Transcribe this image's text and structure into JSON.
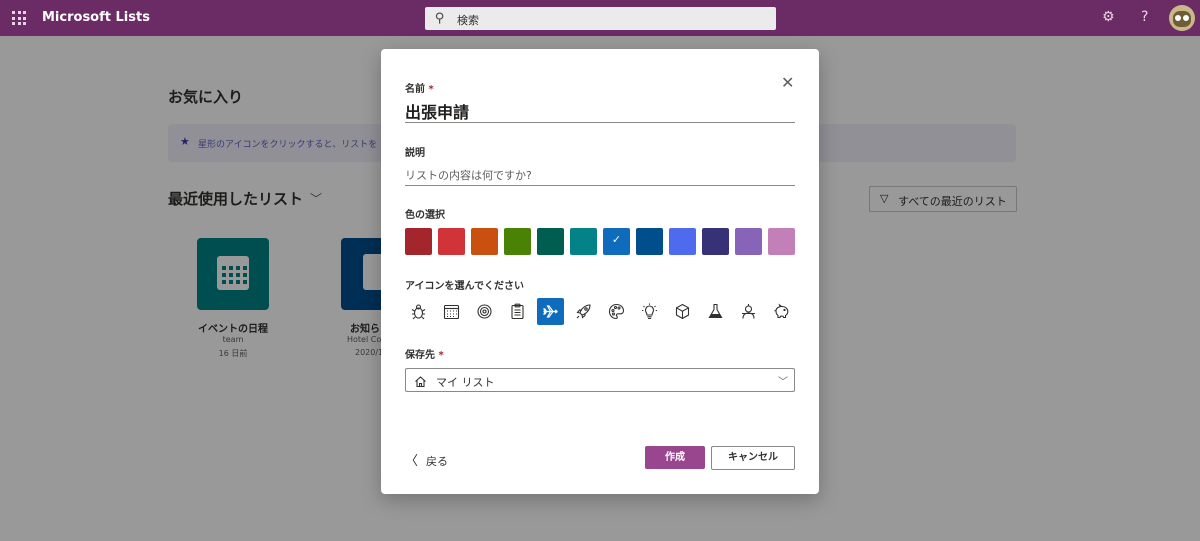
{
  "app": {
    "name": "Microsoft Lists",
    "search_placeholder": "検索"
  },
  "topbar_icons": [
    "waffle-icon",
    "gear-icon",
    "help-icon"
  ],
  "topbar": {
    "help_glyph": "?"
  },
  "background": {
    "favorites_title": "お気に入り",
    "favorites_hint": "星形のアイコンをクリックすると、リストを",
    "recent_title": "最近使用したリスト",
    "all_recent_label": "すべての最近のリスト",
    "tiles": [
      {
        "name": "イベントの日程",
        "owner": "team",
        "date": "16 日前",
        "color": "#038387"
      },
      {
        "name": "お知ら",
        "owner": "Hotel Co",
        "date": "2020/1",
        "color": "#004e8c"
      }
    ]
  },
  "dialog": {
    "name_label": "名前",
    "required_mark": "*",
    "name_value": "出張申請",
    "description_label": "説明",
    "description_placeholder": "リストの内容は何ですか?",
    "color_label": "色の選択",
    "colors": [
      "#a4262c",
      "#d13438",
      "#ca5010",
      "#498205",
      "#005e50",
      "#038387",
      "#0f6cbd",
      "#004e8c",
      "#4f6bed",
      "#373277",
      "#8764b8",
      "#c27fb8"
    ],
    "selected_color_index": 6,
    "icon_label": "アイコンを選んでください",
    "icons": [
      "bug-icon",
      "calendar-icon",
      "target-icon",
      "clipboard-icon",
      "airplane-icon",
      "rocket-icon",
      "palette-icon",
      "lightbulb-icon",
      "cube-icon",
      "flask-icon",
      "robot-icon",
      "piggy-bank-icon"
    ],
    "selected_icon_index": 4,
    "save_label": "保存先",
    "save_value": "マイ リスト",
    "back_label": "戻る",
    "create_label": "作成",
    "cancel_label": "キャンセル",
    "accent_color": "#99468f"
  }
}
